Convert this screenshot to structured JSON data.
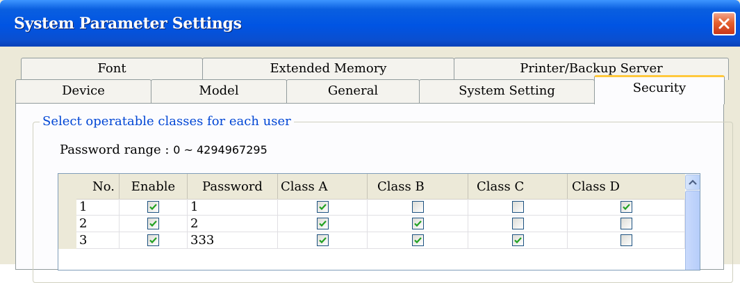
{
  "window": {
    "title": "System Parameter Settings"
  },
  "tabs": {
    "row1": [
      "Font",
      "Extended Memory",
      "Printer/Backup Server"
    ],
    "row2": [
      "Device",
      "Model",
      "General",
      "System Setting",
      "Security"
    ],
    "active": "Security"
  },
  "security": {
    "group_label": "Select operatable classes for each user",
    "password_range_label": "Password range : ",
    "password_range_value": "0 ~ 4294967295",
    "columns": [
      "No.",
      "Enable",
      "Password",
      "Class A",
      "Class B",
      "Class C",
      "Class D"
    ],
    "rows": [
      {
        "no": "1",
        "enable": true,
        "password": "1",
        "class_a": true,
        "class_b": false,
        "class_c": false,
        "class_d": true
      },
      {
        "no": "2",
        "enable": true,
        "password": "2",
        "class_a": true,
        "class_b": true,
        "class_c": false,
        "class_d": false
      },
      {
        "no": "3",
        "enable": true,
        "password": "333",
        "class_a": true,
        "class_b": true,
        "class_c": true,
        "class_d": false
      }
    ]
  },
  "icons": {
    "close": "close-icon",
    "scroll_up": "scroll-up-arrow-icon",
    "check": "check-icon"
  },
  "colors": {
    "title_bar": "#0054e3",
    "close_button": "#e4612e",
    "active_tab_highlight": "#ffc83c",
    "group_label": "#0046d5",
    "checkmark": "#21a121"
  }
}
